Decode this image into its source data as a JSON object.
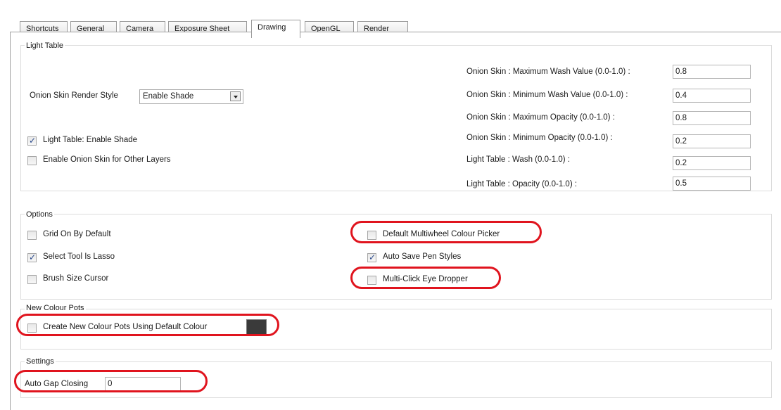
{
  "tabs": [
    "Shortcuts",
    "General",
    "Camera",
    "Exposure Sheet",
    "Drawing",
    "OpenGL",
    "Render"
  ],
  "active_tab": "Drawing",
  "light_table": {
    "title": "Light Table",
    "render_style_label": "Onion Skin Render Style",
    "render_style_value": "Enable Shade",
    "enable_shade_label": "Light Table: Enable Shade",
    "enable_shade_checked": true,
    "onion_other_layers_label": "Enable Onion Skin for Other Layers",
    "onion_other_layers_checked": false,
    "fields": [
      {
        "label": "Onion Skin : Maximum Wash Value (0.0-1.0) :",
        "value": "0.8"
      },
      {
        "label": "Onion Skin : Minimum Wash Value (0.0-1.0) :",
        "value": "0.4"
      },
      {
        "label": "Onion Skin : Maximum Opacity (0.0-1.0) :",
        "value": "0.8"
      },
      {
        "label": "Onion Skin : Minimum Opacity (0.0-1.0) :",
        "value": "0.2"
      },
      {
        "label": "Light Table : Wash (0.0-1.0) :",
        "value": "0.2"
      },
      {
        "label": "Light Table : Opacity (0.0-1.0) :",
        "value": "0.5"
      }
    ]
  },
  "options": {
    "title": "Options",
    "items": [
      {
        "label": "Grid On By Default",
        "checked": false
      },
      {
        "label": "Select Tool Is Lasso",
        "checked": true
      },
      {
        "label": "Brush Size Cursor",
        "checked": false
      },
      {
        "label": "Default Multiwheel Colour Picker",
        "checked": false
      },
      {
        "label": "Auto Save Pen Styles",
        "checked": true
      },
      {
        "label": "Multi-Click Eye Dropper",
        "checked": false
      }
    ]
  },
  "new_colour_pots": {
    "title": "New Colour Pots",
    "label": "Create New Colour Pots Using Default Colour",
    "checked": false,
    "swatch_color": "#3a3a3a"
  },
  "settings": {
    "title": "Settings",
    "auto_gap_label": "Auto Gap Closing",
    "auto_gap_value": "0"
  },
  "highlight_color": "#e0141e",
  "check_glyph": "✓"
}
